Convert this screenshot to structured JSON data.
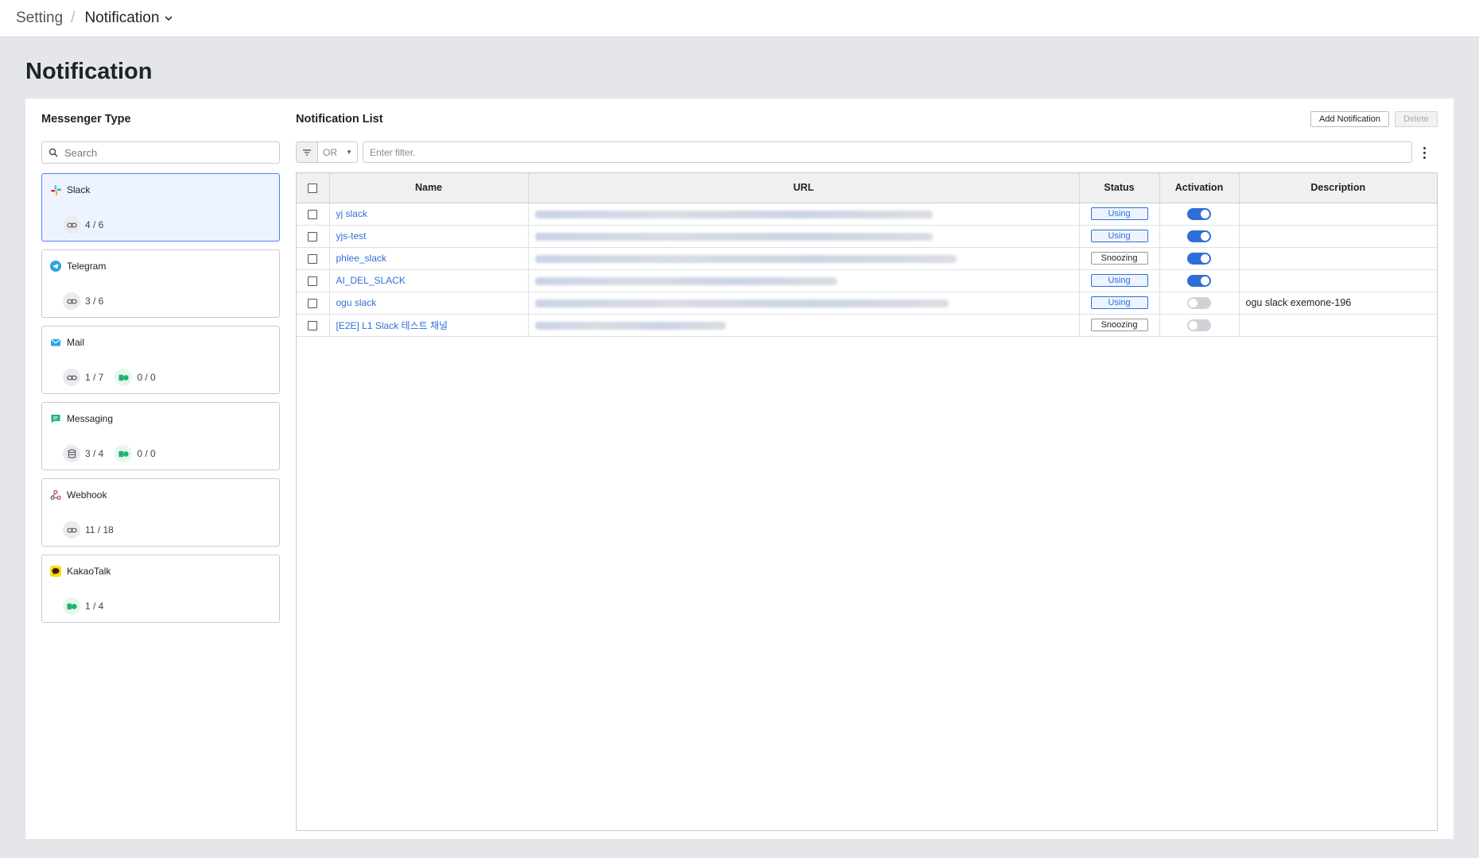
{
  "breadcrumb": {
    "root": "Setting",
    "separator": "/",
    "current": "Notification"
  },
  "page_title": "Notification",
  "messenger": {
    "title": "Messenger Type",
    "search_placeholder": "Search",
    "cards": [
      {
        "name": "Slack",
        "icon": "slack-icon",
        "stats": [
          {
            "icon": "link-icon",
            "text": "4 / 6"
          }
        ]
      },
      {
        "name": "Telegram",
        "icon": "telegram-icon",
        "stats": [
          {
            "icon": "link-icon",
            "text": "3 / 6"
          }
        ]
      },
      {
        "name": "Mail",
        "icon": "mail-icon",
        "stats": [
          {
            "icon": "link-icon",
            "text": "1 / 7"
          },
          {
            "icon": "toggle-status-icon",
            "text": "0 / 0"
          }
        ]
      },
      {
        "name": "Messaging",
        "icon": "message-icon",
        "stats": [
          {
            "icon": "database-icon",
            "text": "3 / 4"
          },
          {
            "icon": "toggle-status-icon",
            "text": "0 / 0"
          }
        ]
      },
      {
        "name": "Webhook",
        "icon": "webhook-icon",
        "stats": [
          {
            "icon": "link-icon",
            "text": "11 / 18"
          }
        ]
      },
      {
        "name": "KakaoTalk",
        "icon": "kakaotalk-icon",
        "stats": [
          {
            "icon": "toggle-status-icon",
            "text": "1 / 4"
          }
        ]
      }
    ]
  },
  "notification_list": {
    "title": "Notification List",
    "add_label": "Add Notification",
    "delete_label": "Delete",
    "filter": {
      "operator": "OR",
      "placeholder": "Enter filter."
    },
    "columns": {
      "name": "Name",
      "url": "URL",
      "status": "Status",
      "activation": "Activation",
      "description": "Description"
    },
    "rows": [
      {
        "name": "yj slack",
        "status": "Using",
        "active": true,
        "description": ""
      },
      {
        "name": "yjs-test",
        "status": "Using",
        "active": true,
        "description": ""
      },
      {
        "name": "phlee_slack",
        "status": "Snoozing",
        "active": true,
        "description": ""
      },
      {
        "name": "AI_DEL_SLACK",
        "status": "Using",
        "active": true,
        "description": ""
      },
      {
        "name": "ogu slack",
        "status": "Using",
        "active": false,
        "description": "ogu slack exemone-196"
      },
      {
        "name": "[E2E] L1 Slack 테스트 채널",
        "status": "Snoozing",
        "active": false,
        "description": ""
      }
    ]
  },
  "colors": {
    "accent": "#2e6fd6",
    "selected_card_bg": "#eef4ff",
    "page_bg": "#e4e6ea"
  }
}
